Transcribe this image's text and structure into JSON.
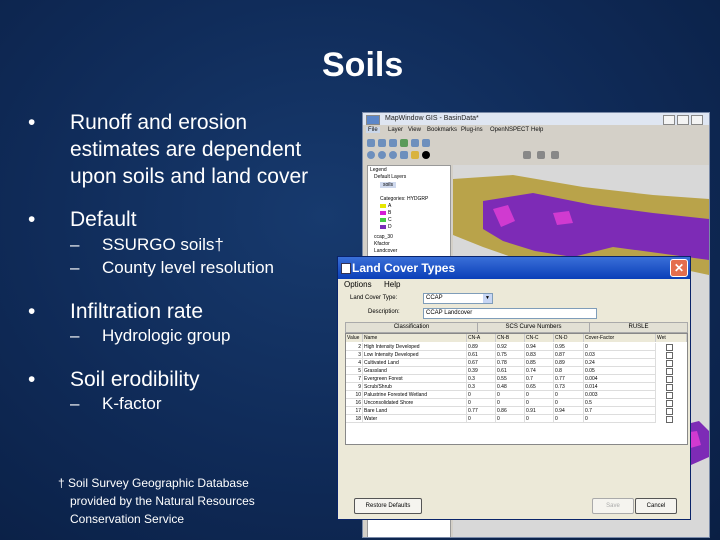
{
  "slide": {
    "title": "Soils",
    "bullets": [
      {
        "lines": [
          "Runoff and erosion",
          "estimates are dependent",
          "upon soils and land cover"
        ]
      },
      {
        "lines": [
          "Default"
        ],
        "subs": [
          "SSURGO soils†",
          "County level resolution"
        ]
      },
      {
        "lines": [
          "Infiltration rate"
        ],
        "subs": [
          "Hydrologic group"
        ]
      },
      {
        "lines": [
          "Soil erodibility"
        ],
        "subs": [
          "K-factor"
        ]
      }
    ],
    "footnote": [
      "† Soil Survey Geographic Database",
      "provided by the Natural Resources",
      "Conservation Service"
    ],
    "bullet_symbol": "•",
    "sub_symbol": "–"
  },
  "mapwindow": {
    "title": "MapWindow GIS - BasinData*",
    "menu": [
      "File",
      "Layer",
      "View",
      "Bookmarks",
      "Plug-ins",
      "OpenNSPECT",
      "Help"
    ],
    "legend": {
      "header": "Legend",
      "group": "Default Layers",
      "layer": "soils",
      "categories_label": "Categories: HYDGRP",
      "classes": [
        {
          "label": "A",
          "color": "#e6e600"
        },
        {
          "label": "B",
          "color": "#d41ed4"
        },
        {
          "label": "C",
          "color": "#44cc44"
        },
        {
          "label": "D",
          "color": "#7a2fb8"
        }
      ],
      "other_layers": [
        "ccap_30",
        "Kfactor",
        "Landcover"
      ]
    },
    "map_colors": {
      "land": "#b9a34a",
      "purple": "#7d2bb6",
      "magenta": "#d03ad0",
      "water": "#d8d8d8"
    }
  },
  "dialog": {
    "title": "Land Cover Types",
    "menu": [
      "Options",
      "Help"
    ],
    "land_cover_type_label": "Land Cover Type:",
    "land_cover_type_value": "CCAP",
    "description_label": "Description:",
    "description_value": "CCAP Landcover",
    "groups": [
      "Classification",
      "SCS Curve Numbers",
      "RUSLE"
    ],
    "columns": [
      "Value",
      "Name",
      "CN-A",
      "CN-B",
      "CN-C",
      "CN-D",
      "Cover-Factor",
      "Wet"
    ],
    "rows": [
      {
        "value": "2",
        "name": "High Intensity Developed",
        "a": "0.89",
        "b": "0.92",
        "c": "0.94",
        "d": "0.95",
        "cf": "0",
        "wet": false
      },
      {
        "value": "3",
        "name": "Low Intensity Developed",
        "a": "0.61",
        "b": "0.75",
        "c": "0.83",
        "d": "0.87",
        "cf": "0.03",
        "wet": false
      },
      {
        "value": "4",
        "name": "Cultivated Land",
        "a": "0.67",
        "b": "0.78",
        "c": "0.85",
        "d": "0.89",
        "cf": "0.24",
        "wet": false
      },
      {
        "value": "5",
        "name": "Grassland",
        "a": "0.39",
        "b": "0.61",
        "c": "0.74",
        "d": "0.8",
        "cf": "0.05",
        "wet": false
      },
      {
        "value": "7",
        "name": "Evergreen Forest",
        "a": "0.3",
        "b": "0.55",
        "c": "0.7",
        "d": "0.77",
        "cf": "0.004",
        "wet": false
      },
      {
        "value": "9",
        "name": "Scrub/Shrub",
        "a": "0.3",
        "b": "0.48",
        "c": "0.65",
        "d": "0.73",
        "cf": "0.014",
        "wet": false
      },
      {
        "value": "10",
        "name": "Palustrine Forested Wetland",
        "a": "0",
        "b": "0",
        "c": "0",
        "d": "0",
        "cf": "0.003",
        "wet": false
      },
      {
        "value": "16",
        "name": "Unconsolidated Shore",
        "a": "0",
        "b": "0",
        "c": "0",
        "d": "0",
        "cf": "0.5",
        "wet": false
      },
      {
        "value": "17",
        "name": "Bare Land",
        "a": "0.77",
        "b": "0.86",
        "c": "0.91",
        "d": "0.94",
        "cf": "0.7",
        "wet": false
      },
      {
        "value": "18",
        "name": "Water",
        "a": "0",
        "b": "0",
        "c": "0",
        "d": "0",
        "cf": "0",
        "wet": true
      }
    ],
    "buttons": {
      "restore": "Restore Defaults",
      "save": "Save",
      "cancel": "Cancel"
    },
    "close_glyph": "✕"
  }
}
